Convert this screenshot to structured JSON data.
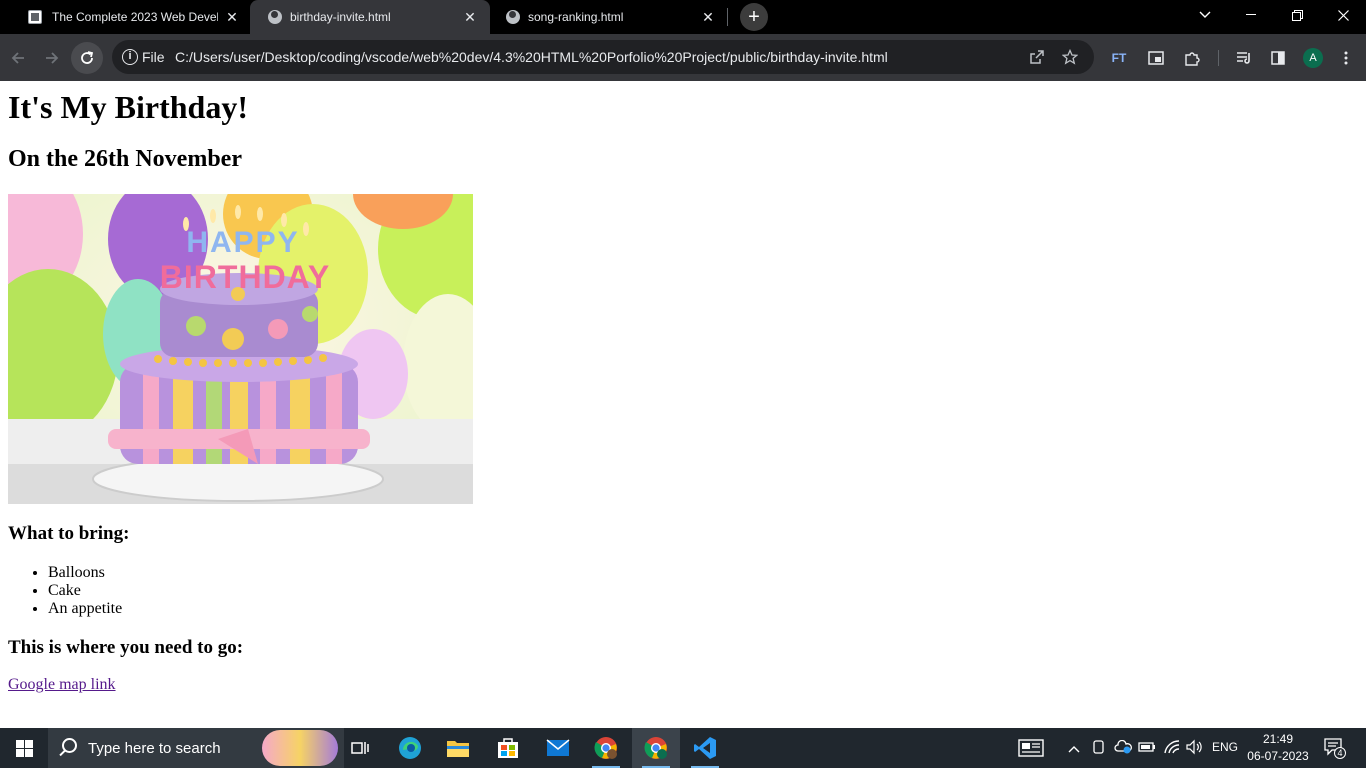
{
  "browser": {
    "tabs": [
      {
        "title": "The Complete 2023 Web Develo",
        "active": false
      },
      {
        "title": "birthday-invite.html",
        "active": true
      },
      {
        "title": "song-ranking.html",
        "active": false
      }
    ],
    "omnibox": {
      "scheme_label": "File",
      "url": "C:/Users/user/Desktop/coding/vscode/web%20dev/4.3%20HTML%20Porfolio%20Project/public/birthday-invite.html"
    },
    "extension_label": "FT",
    "avatar_initial": "A"
  },
  "page": {
    "heading": "It's My Birthday!",
    "date_heading": "On the 26th November",
    "image": {
      "topper_line1": "HAPPY",
      "topper_line2": "BIRTHDAY"
    },
    "bring_heading": "What to bring:",
    "bring_items": [
      "Balloons",
      "Cake",
      "An appetite"
    ],
    "where_heading": "This is where you need to go:",
    "map_link_text": "Google map link"
  },
  "taskbar": {
    "search_placeholder": "Type here to search",
    "language": "ENG",
    "time": "21:49",
    "date": "06-07-2023",
    "notification_count": "4"
  },
  "colors": {
    "tabstrip": "#000000",
    "toolbar": "#35363a",
    "omnibox": "#202124",
    "taskbar": "#20272e",
    "visited_link": "#551a8b"
  }
}
